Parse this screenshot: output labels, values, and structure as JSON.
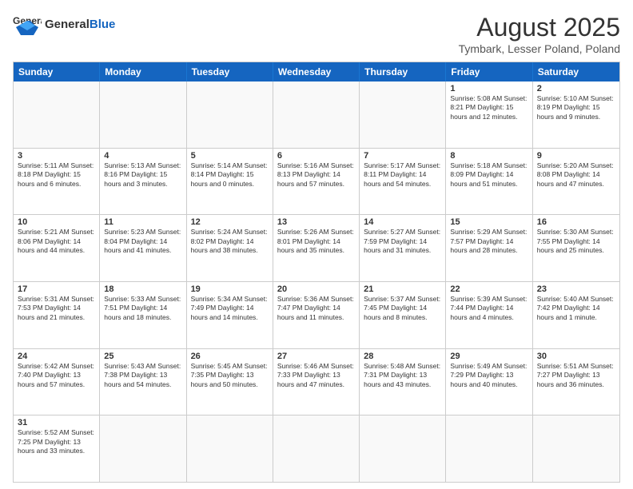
{
  "header": {
    "logo_general": "General",
    "logo_blue": "Blue",
    "month_title": "August 2025",
    "location": "Tymbark, Lesser Poland, Poland"
  },
  "days_of_week": [
    "Sunday",
    "Monday",
    "Tuesday",
    "Wednesday",
    "Thursday",
    "Friday",
    "Saturday"
  ],
  "weeks": [
    [
      {
        "day": "",
        "info": ""
      },
      {
        "day": "",
        "info": ""
      },
      {
        "day": "",
        "info": ""
      },
      {
        "day": "",
        "info": ""
      },
      {
        "day": "",
        "info": ""
      },
      {
        "day": "1",
        "info": "Sunrise: 5:08 AM\nSunset: 8:21 PM\nDaylight: 15 hours and 12 minutes."
      },
      {
        "day": "2",
        "info": "Sunrise: 5:10 AM\nSunset: 8:19 PM\nDaylight: 15 hours and 9 minutes."
      }
    ],
    [
      {
        "day": "3",
        "info": "Sunrise: 5:11 AM\nSunset: 8:18 PM\nDaylight: 15 hours and 6 minutes."
      },
      {
        "day": "4",
        "info": "Sunrise: 5:13 AM\nSunset: 8:16 PM\nDaylight: 15 hours and 3 minutes."
      },
      {
        "day": "5",
        "info": "Sunrise: 5:14 AM\nSunset: 8:14 PM\nDaylight: 15 hours and 0 minutes."
      },
      {
        "day": "6",
        "info": "Sunrise: 5:16 AM\nSunset: 8:13 PM\nDaylight: 14 hours and 57 minutes."
      },
      {
        "day": "7",
        "info": "Sunrise: 5:17 AM\nSunset: 8:11 PM\nDaylight: 14 hours and 54 minutes."
      },
      {
        "day": "8",
        "info": "Sunrise: 5:18 AM\nSunset: 8:09 PM\nDaylight: 14 hours and 51 minutes."
      },
      {
        "day": "9",
        "info": "Sunrise: 5:20 AM\nSunset: 8:08 PM\nDaylight: 14 hours and 47 minutes."
      }
    ],
    [
      {
        "day": "10",
        "info": "Sunrise: 5:21 AM\nSunset: 8:06 PM\nDaylight: 14 hours and 44 minutes."
      },
      {
        "day": "11",
        "info": "Sunrise: 5:23 AM\nSunset: 8:04 PM\nDaylight: 14 hours and 41 minutes."
      },
      {
        "day": "12",
        "info": "Sunrise: 5:24 AM\nSunset: 8:02 PM\nDaylight: 14 hours and 38 minutes."
      },
      {
        "day": "13",
        "info": "Sunrise: 5:26 AM\nSunset: 8:01 PM\nDaylight: 14 hours and 35 minutes."
      },
      {
        "day": "14",
        "info": "Sunrise: 5:27 AM\nSunset: 7:59 PM\nDaylight: 14 hours and 31 minutes."
      },
      {
        "day": "15",
        "info": "Sunrise: 5:29 AM\nSunset: 7:57 PM\nDaylight: 14 hours and 28 minutes."
      },
      {
        "day": "16",
        "info": "Sunrise: 5:30 AM\nSunset: 7:55 PM\nDaylight: 14 hours and 25 minutes."
      }
    ],
    [
      {
        "day": "17",
        "info": "Sunrise: 5:31 AM\nSunset: 7:53 PM\nDaylight: 14 hours and 21 minutes."
      },
      {
        "day": "18",
        "info": "Sunrise: 5:33 AM\nSunset: 7:51 PM\nDaylight: 14 hours and 18 minutes."
      },
      {
        "day": "19",
        "info": "Sunrise: 5:34 AM\nSunset: 7:49 PM\nDaylight: 14 hours and 14 minutes."
      },
      {
        "day": "20",
        "info": "Sunrise: 5:36 AM\nSunset: 7:47 PM\nDaylight: 14 hours and 11 minutes."
      },
      {
        "day": "21",
        "info": "Sunrise: 5:37 AM\nSunset: 7:45 PM\nDaylight: 14 hours and 8 minutes."
      },
      {
        "day": "22",
        "info": "Sunrise: 5:39 AM\nSunset: 7:44 PM\nDaylight: 14 hours and 4 minutes."
      },
      {
        "day": "23",
        "info": "Sunrise: 5:40 AM\nSunset: 7:42 PM\nDaylight: 14 hours and 1 minute."
      }
    ],
    [
      {
        "day": "24",
        "info": "Sunrise: 5:42 AM\nSunset: 7:40 PM\nDaylight: 13 hours and 57 minutes."
      },
      {
        "day": "25",
        "info": "Sunrise: 5:43 AM\nSunset: 7:38 PM\nDaylight: 13 hours and 54 minutes."
      },
      {
        "day": "26",
        "info": "Sunrise: 5:45 AM\nSunset: 7:35 PM\nDaylight: 13 hours and 50 minutes."
      },
      {
        "day": "27",
        "info": "Sunrise: 5:46 AM\nSunset: 7:33 PM\nDaylight: 13 hours and 47 minutes."
      },
      {
        "day": "28",
        "info": "Sunrise: 5:48 AM\nSunset: 7:31 PM\nDaylight: 13 hours and 43 minutes."
      },
      {
        "day": "29",
        "info": "Sunrise: 5:49 AM\nSunset: 7:29 PM\nDaylight: 13 hours and 40 minutes."
      },
      {
        "day": "30",
        "info": "Sunrise: 5:51 AM\nSunset: 7:27 PM\nDaylight: 13 hours and 36 minutes."
      }
    ],
    [
      {
        "day": "31",
        "info": "Sunrise: 5:52 AM\nSunset: 7:25 PM\nDaylight: 13 hours and 33 minutes."
      },
      {
        "day": "",
        "info": ""
      },
      {
        "day": "",
        "info": ""
      },
      {
        "day": "",
        "info": ""
      },
      {
        "day": "",
        "info": ""
      },
      {
        "day": "",
        "info": ""
      },
      {
        "day": "",
        "info": ""
      }
    ]
  ]
}
